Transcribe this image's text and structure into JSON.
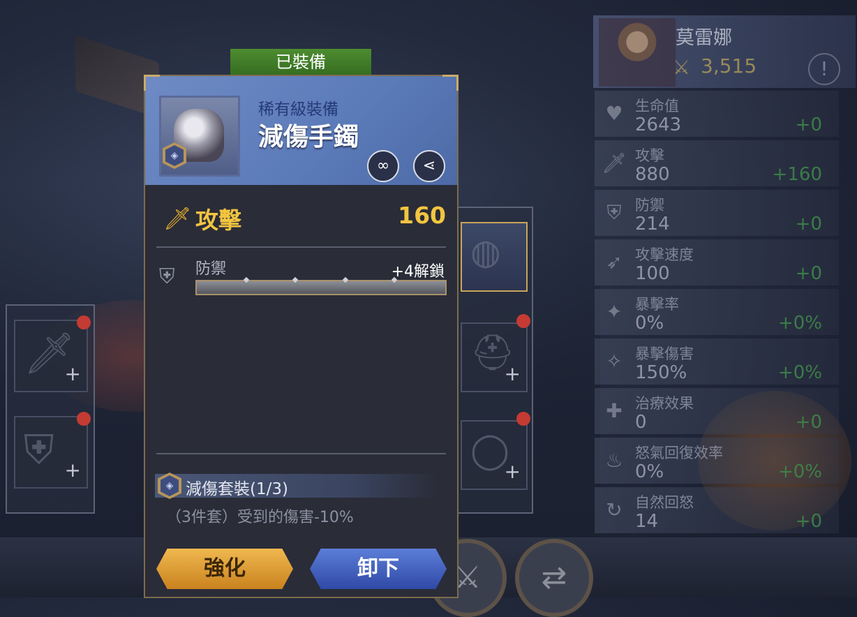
{
  "popup": {
    "equipped_tag": "已裝備",
    "item": {
      "rarity": "稀有級裝備",
      "name": "減傷手鐲",
      "badge_icon": "shield-icon",
      "share_icon": "share-icon",
      "link_icon": "chain-icon"
    },
    "main_stat": {
      "label": "攻擊",
      "value": "160",
      "icon": "sword-icon"
    },
    "sub_stat": {
      "label": "防禦",
      "unlock": "+4解鎖",
      "icon": "shield-icon"
    },
    "set": {
      "title": "減傷套裝(1/3)",
      "description": "（3件套）受到的傷害-10%"
    },
    "buttons": {
      "enhance": "強化",
      "unequip": "卸下"
    }
  },
  "hero": {
    "name": "莫雷娜",
    "power": "3,515",
    "alert": "!"
  },
  "stats": [
    {
      "label": "生命值",
      "value": "2643",
      "delta": "+0",
      "icon": "heart-icon"
    },
    {
      "label": "攻擊",
      "value": "880",
      "delta": "+160",
      "icon": "sword-icon"
    },
    {
      "label": "防禦",
      "value": "214",
      "delta": "+0",
      "icon": "shield-icon"
    },
    {
      "label": "攻擊速度",
      "value": "100",
      "delta": "+0",
      "icon": "wing-icon"
    },
    {
      "label": "暴擊率",
      "value": "0%",
      "delta": "+0%",
      "icon": "crit-icon"
    },
    {
      "label": "暴擊傷害",
      "value": "150%",
      "delta": "+0%",
      "icon": "crit-damage-icon"
    },
    {
      "label": "治療效果",
      "value": "0",
      "delta": "+0",
      "icon": "heal-icon"
    },
    {
      "label": "怒氣回復效率",
      "value": "0%",
      "delta": "+0%",
      "icon": "rage-icon"
    },
    {
      "label": "自然回怒",
      "value": "14",
      "delta": "+0",
      "icon": "rage-regen-icon"
    }
  ],
  "equip_slots": {
    "plus_label": "+"
  },
  "colors": {
    "gold": "#f2c540",
    "green_delta": "#3f8a4a",
    "equipped_green": "#4d8c2f",
    "enhance_orange": "#e0a23a",
    "unequip_blue": "#3f5fc0"
  }
}
